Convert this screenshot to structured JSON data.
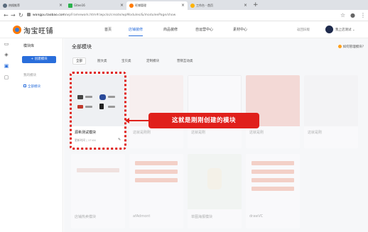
{
  "browser": {
    "tabs": [
      {
        "label": "热搜推荐",
        "favicon_color": "#5a6b7d"
      },
      {
        "label": "Gitee16",
        "favicon_color": "#2bb24c"
      },
      {
        "label": "旺铺管理",
        "favicon_color": "#ff7a00"
      },
      {
        "label": "工作台 - 首页",
        "favicon_color": "#ffb300"
      }
    ],
    "url_domain": "wangpu.taobao.com",
    "url_path": "/wpFramework.htm#/wpcks/create/wpModules/&/moduleePage/show"
  },
  "app": {
    "logo_text": "淘宝旺铺",
    "nav": [
      "首页",
      "店铺装修",
      "商品装修",
      "自运营中心",
      "素材中心"
    ],
    "active_nav": 1,
    "back_to_old": "返回旧版",
    "user": "我上店测试"
  },
  "sidebar": {
    "title": "模块库",
    "new_button": "+ 创建模块",
    "group_label": "我的模块",
    "item": "全部模块"
  },
  "main": {
    "title": "全部模块",
    "help_link": "如何管理模块?",
    "filters": [
      "全部",
      "图文类",
      "宝贝类",
      "定制模块",
      "营销互动类"
    ],
    "active_filter": 0,
    "highlighted_card": {
      "name": "源希测试模块",
      "meta": "更新时间 | 17:04"
    },
    "faded_cards": [
      {
        "name": "这就是刚刚"
      },
      {
        "name": "这就是刚"
      },
      {
        "name": "这就是刚"
      },
      {
        "name": "这就是刚"
      },
      {
        "name": "店铺热卖模块"
      },
      {
        "name": "afAdmont"
      },
      {
        "name": "单图海报模块"
      },
      {
        "name": "drawVC"
      }
    ]
  },
  "annotation": {
    "callout_text": "这就是刚刚创建的模块"
  },
  "colors": {
    "accent": "#2a6edb",
    "annotation_red": "#e0201b",
    "brand_orange": "#ff7a00"
  }
}
